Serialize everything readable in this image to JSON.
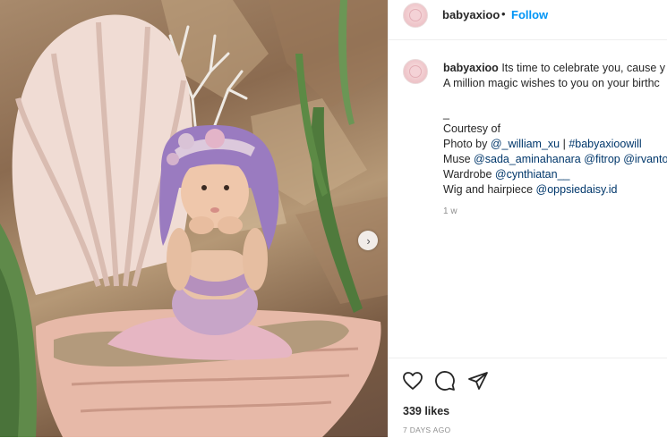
{
  "header": {
    "username": "babyaxioo",
    "separator": "•",
    "follow_label": "Follow"
  },
  "caption": {
    "username": "babyaxioo",
    "line1": "Its time to celebrate you, cause y",
    "line2": "A million magic wishes to you on your birthc",
    "line3": "_",
    "line4": "Courtesy of",
    "line5_prefix": "Photo by ",
    "line5_tag1": "@_william_xu",
    "line5_sep": " | ",
    "line5_tag2": "#babyaxioowill",
    "line6_prefix": "Muse ",
    "line6_tag1": "@sada_aminahanara",
    "line6_tag2": "@fitrop",
    "line6_tag3": "@irvanto",
    "line7_prefix": "Wardrobe ",
    "line7_tag": "@cynthiatan__",
    "line8_prefix": "Wig and hairpiece ",
    "line8_tag": "@oppsiedaisy.id",
    "time": "1 w"
  },
  "actions": {
    "likes": "339 likes",
    "ago": "7 DAYS AGO"
  },
  "icons": {
    "like": "heart-icon",
    "comment": "comment-icon",
    "share": "paper-plane-icon",
    "next": "chevron-right-icon"
  },
  "colors": {
    "link": "#00376b",
    "follow": "#0095f6",
    "muted": "#8e8e8e"
  }
}
